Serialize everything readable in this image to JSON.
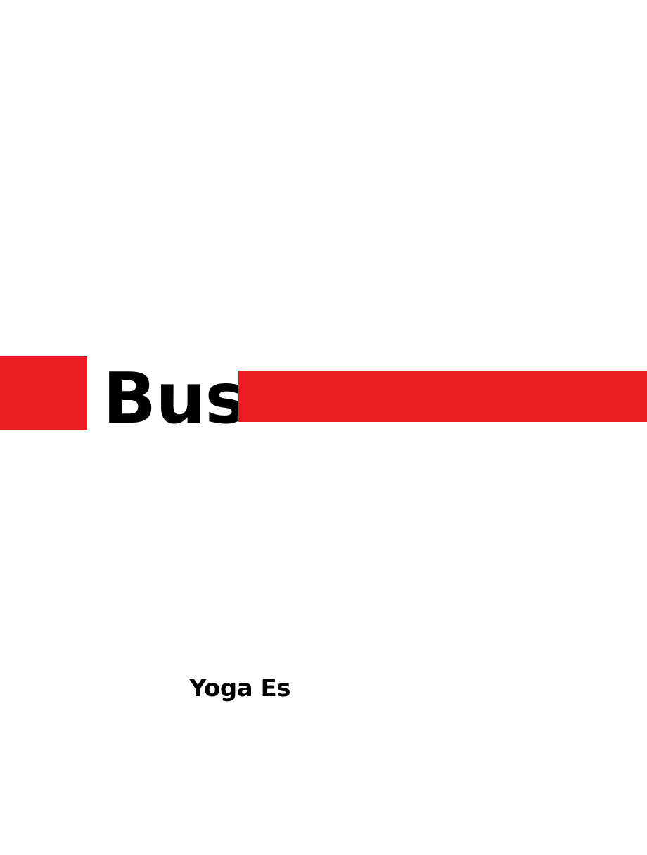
{
  "cover": {
    "title": "Bus",
    "author": "Yoga Es",
    "accent_color": "#ed1c24"
  }
}
